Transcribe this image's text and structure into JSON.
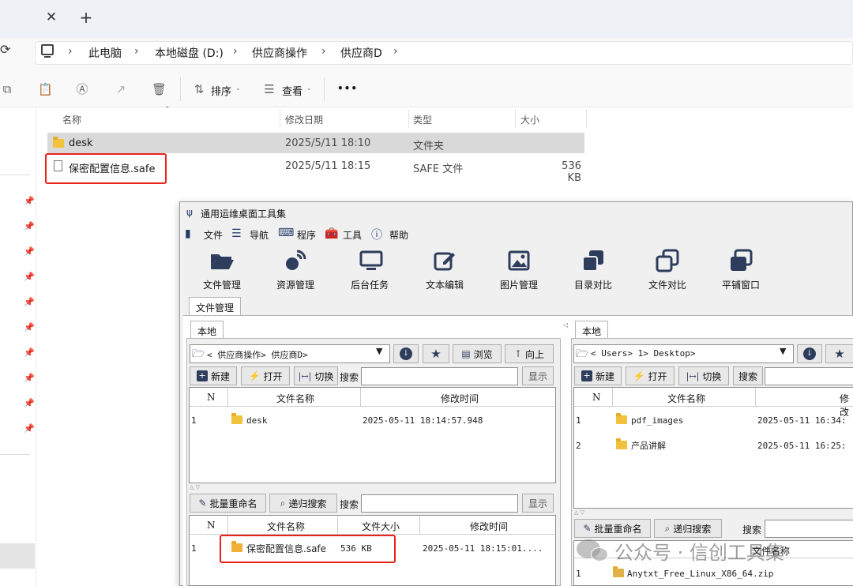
{
  "explorer": {
    "breadcrumb": [
      "此电脑",
      "本地磁盘 (D:)",
      "供应商操作",
      "供应商D"
    ],
    "toolbar": {
      "sort_label": "排序",
      "view_label": "查看",
      "more_label": "•••"
    },
    "columns": [
      "名称",
      "修改日期",
      "类型",
      "大小"
    ],
    "rows": [
      {
        "name": "desk",
        "date": "2025/5/11 18:10",
        "type": "文件夹",
        "size": ""
      },
      {
        "name": "保密配置信息.safe",
        "date": "2025/5/11 18:15",
        "type": "SAFE 文件",
        "size": "536 KB"
      }
    ]
  },
  "tool": {
    "title": "通用运维桌面工具集",
    "menu": [
      "文件",
      "导航",
      "程序",
      "工具",
      "帮助"
    ],
    "ribbon": [
      "文件管理",
      "资源管理",
      "后台任务",
      "文本编辑",
      "图片管理",
      "目录对比",
      "文件对比",
      "平铺窗口"
    ],
    "main_tab": "文件管理",
    "left": {
      "tab": "本地",
      "path": "< 供应商操作> 供应商D>",
      "browse": "浏览",
      "up": "向上",
      "new": "新建",
      "open": "打开",
      "switch": "切换",
      "search": "搜索",
      "show": "显示",
      "columns": [
        "N",
        "文件名称",
        "修改时间"
      ],
      "rows": [
        {
          "n": "1",
          "name": "desk",
          "time": "2025-05-11 18:14:57.948"
        }
      ],
      "batch_rename": "批量重命名",
      "recursive_search": "递归搜索",
      "search2": "搜索",
      "show2": "显示",
      "columns2": [
        "N",
        "文件名称",
        "文件大小",
        "修改时间"
      ],
      "rows2": [
        {
          "n": "1",
          "name": "保密配置信息.safe",
          "size": "536 KB",
          "time": "2025-05-11 18:15:01...."
        }
      ]
    },
    "right": {
      "tab": "本地",
      "path": "< Users> 1> Desktop>",
      "new": "新建",
      "open": "打开",
      "switch": "切换",
      "search": "搜索",
      "columns": [
        "N",
        "文件名称",
        "修改"
      ],
      "rows": [
        {
          "n": "1",
          "name": "pdf_images",
          "time": "2025-05-11 16:34:"
        },
        {
          "n": "2",
          "name": "产品讲解",
          "time": "2025-05-11 16:25:"
        }
      ],
      "batch_rename": "批量重命名",
      "recursive_search": "递归搜索",
      "search2": "搜索",
      "col2_partial": "文件名称",
      "rows2": [
        {
          "n": "1",
          "name": "Anytxt_Free_Linux_X86_64.zip"
        }
      ]
    }
  },
  "watermark": "公众号 · 信创工具集",
  "colors": {
    "highlight_red": "#e8231a",
    "folder_yellow": "#f3c23c",
    "tool_icon_blue": "#243b6a",
    "selection_gray": "#d9d9d9"
  }
}
